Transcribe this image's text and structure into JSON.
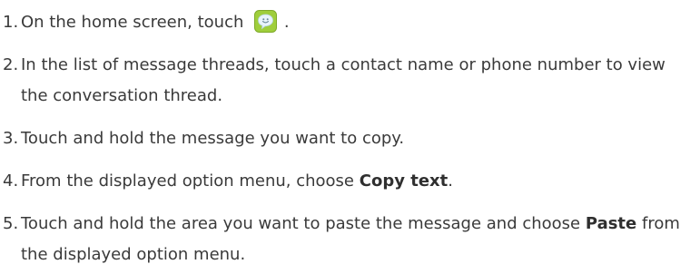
{
  "steps": [
    {
      "number": "1.",
      "text_before": "On the home screen, touch",
      "icon": "messaging-smiley-icon",
      "text_after": "."
    },
    {
      "number": "2.",
      "text": "In the list of message threads, touch a contact name or phone number to view the conversation thread."
    },
    {
      "number": "3.",
      "text": "Touch and hold the message you want to copy."
    },
    {
      "number": "4.",
      "text_before": "From the displayed option menu, choose",
      "bold": "Copy text",
      "text_after": "."
    },
    {
      "number": "5.",
      "text_before": "Touch and hold the area you want to paste the message and choose",
      "bold": "Paste",
      "text_after": "from the displayed option menu."
    }
  ],
  "colors": {
    "text": "#3a3a3a",
    "icon_green": "#9fce3c",
    "icon_blue": "#dfeef8"
  }
}
